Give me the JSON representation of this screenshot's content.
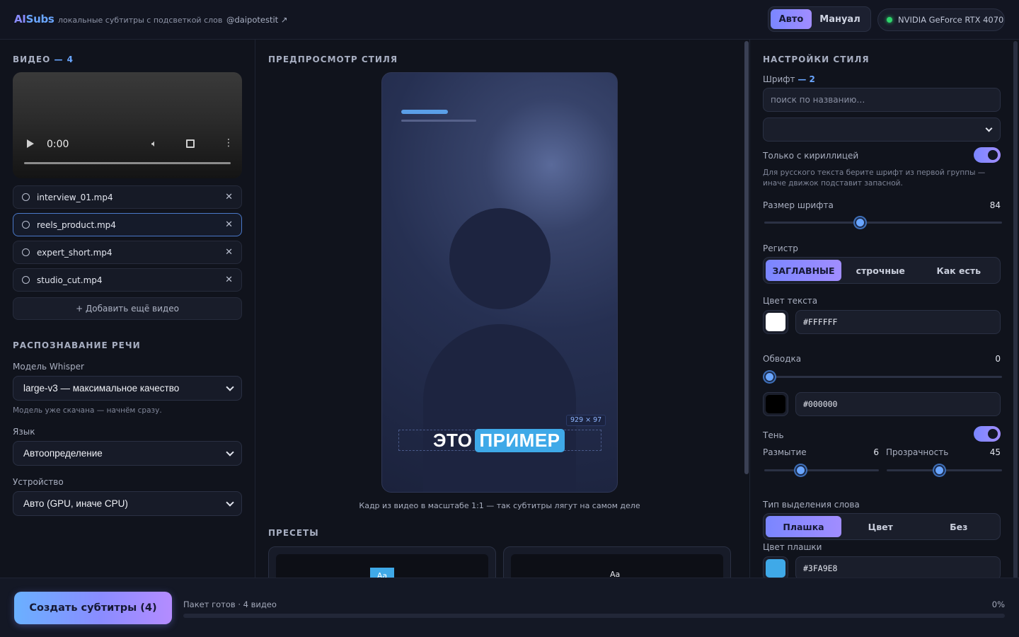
{
  "header": {
    "logo_part1": "AI",
    "logo_part2": "Subs",
    "tagline": "локальные субтитры с подсветкой слов",
    "handle": "@daipotestit ↗",
    "modes": [
      {
        "label": "Авто",
        "active": true
      },
      {
        "label": "Мануал",
        "active": false
      }
    ],
    "gpu": "NVIDIA GeForce RTX 4070",
    "gpu_status_color": "#2fd46b"
  },
  "left": {
    "video_title": "ВИДЕО",
    "video_count": "— 4",
    "player": {
      "time": "0:00"
    },
    "files": [
      {
        "name": "interview_01.mp4",
        "selected": false
      },
      {
        "name": "reels_product.mp4",
        "selected": true
      },
      {
        "name": "expert_short.mp4",
        "selected": false
      },
      {
        "name": "studio_cut.mp4",
        "selected": false
      }
    ],
    "add_video": "+ Добавить ещё видео",
    "speech_title": "РАСПОЗНАВАНИЕ РЕЧИ",
    "model_label": "Модель Whisper",
    "model_value": "large-v3 — максимальное качество",
    "model_hint": "Модель уже скачана — начнём сразу.",
    "language_label": "Язык",
    "language_value": "Автоопределение",
    "device_label": "Устройство",
    "device_value": "Авто (GPU, иначе CPU)"
  },
  "middle": {
    "preview_title": "ПРЕДПРОСМОТР СТИЛЯ",
    "size_badge": "929 × 97",
    "caption_word1": "ЭТО",
    "caption_word2": "ПРИМЕР",
    "preview_note": "Кадр из видео в масштабе 1:1 — так субтитры лягут на самом деле",
    "presets_title": "ПРЕСЕТЫ",
    "preset_labels": [
      "Aa",
      "Aa"
    ]
  },
  "right": {
    "style_title": "НАСТРОЙКИ СТИЛЯ",
    "font_label": "Шрифт",
    "font_count": "— 2",
    "font_search_placeholder": "поиск по названию…",
    "cyrillic_only_label": "Только с кириллицей",
    "cyrillic_only": true,
    "cyrillic_hint": "Для русского текста берите шрифт из первой группы — иначе движок подставит запасной.",
    "font_size_label": "Размер шрифта",
    "font_size_value": "84",
    "font_size_fraction": 0.4,
    "case_label": "Регистр",
    "case_options": [
      {
        "label": "ЗАГЛАВНЫЕ",
        "active": true
      },
      {
        "label": "строчные",
        "active": false
      },
      {
        "label": "Как есть",
        "active": false
      }
    ],
    "text_color_label": "Цвет текста",
    "text_color": "#FFFFFF",
    "stroke_label": "Обводка",
    "stroke_value": "0",
    "stroke_fraction": 0,
    "stroke_color": "#000000",
    "shadow_label": "Тень",
    "shadow_on": true,
    "blur_label": "Размытие",
    "blur_value": "6",
    "blur_fraction": 0.3,
    "opacity_label": "Прозрачность",
    "opacity_value": "45",
    "opacity_fraction": 0.45,
    "highlight_type_label": "Тип выделения слова",
    "highlight_options": [
      {
        "label": "Плашка",
        "active": true
      },
      {
        "label": "Цвет",
        "active": false
      },
      {
        "label": "Без",
        "active": false
      }
    ],
    "plate_color_label": "Цвет плашки",
    "plate_color": "#3FA9E8"
  },
  "footer": {
    "cta": "Создать субтитры (4)",
    "status": "Пакет готов · 4 видео",
    "progress_text": "0%",
    "progress_fraction": 0
  }
}
